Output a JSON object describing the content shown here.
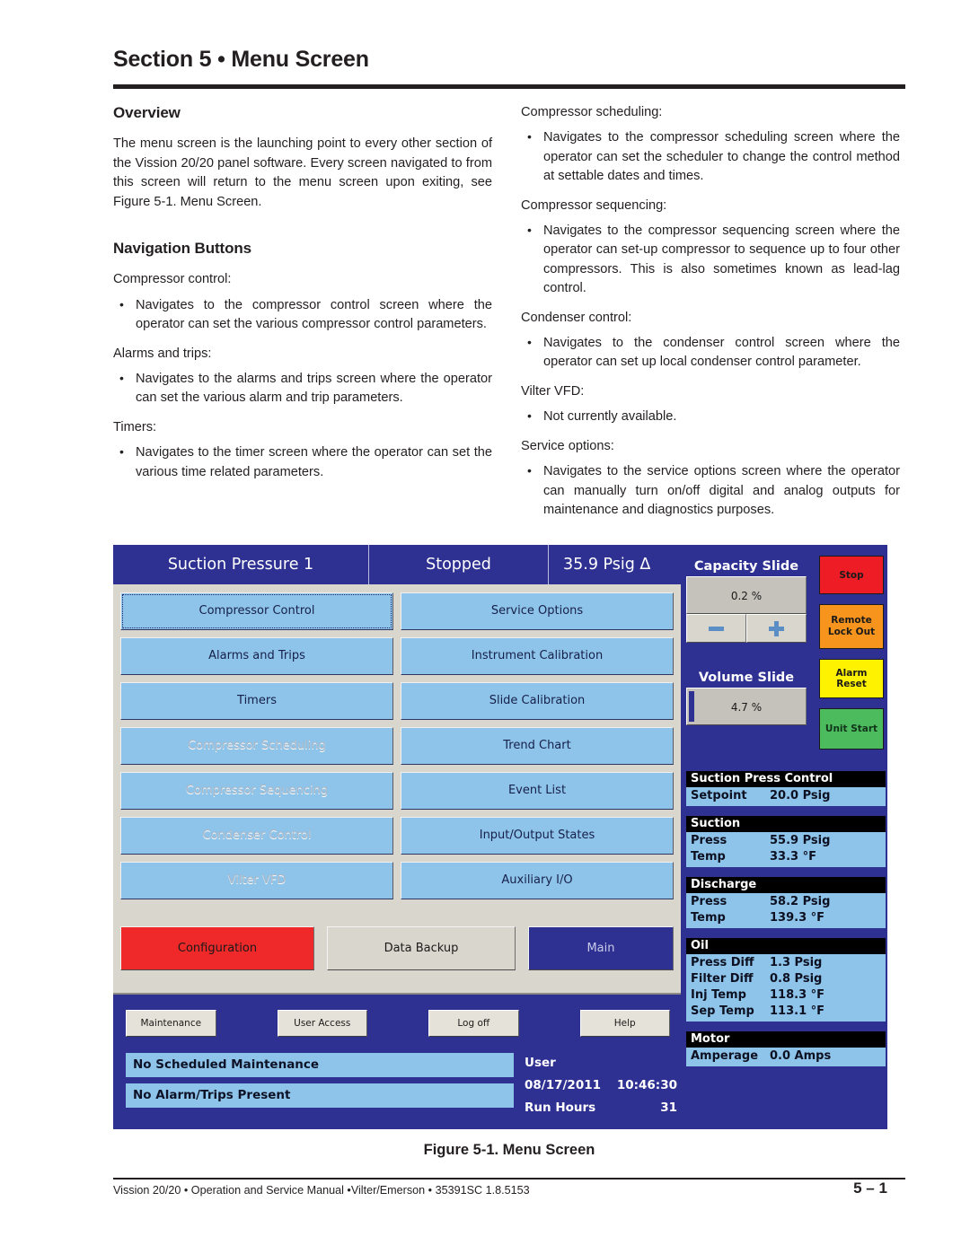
{
  "document": {
    "section_title": "Section 5 • Menu Screen",
    "figure_caption": "Figure 5-1. Menu Screen",
    "footer_text": "Vission 20/20 • Operation and Service Manual •Vilter/Emerson • 35391SC 1.8.5153",
    "page_number": "5  –  1"
  },
  "left_column": {
    "overview_heading": "Overview",
    "overview_paragraph": "The menu screen is the launching point to every other section of the Vission 20/20 panel software. Every screen navigated to from this screen will return to the menu screen upon exiting, see Figure 5-1. Menu Screen.",
    "nav_heading": "Navigation Buttons",
    "items": [
      {
        "lead": "Compressor control:",
        "bullet": "Navigates to the compressor control screen where the operator can set the various compressor control parameters."
      },
      {
        "lead": "Alarms and trips:",
        "bullet": "Navigates to the alarms and trips screen where the operator can set the various alarm and trip parameters."
      },
      {
        "lead": "Timers:",
        "bullet": "Navigates to the timer screen where the operator can set the various time related parameters."
      }
    ]
  },
  "right_column": {
    "items": [
      {
        "lead": "Compressor scheduling:",
        "bullet": "Navigates to the compressor scheduling screen where the operator can set the scheduler to change the control method at settable dates and times."
      },
      {
        "lead": "Compressor sequencing:",
        "bullet": "Navigates to the compressor sequencing screen where the operator can set-up compressor to sequence up to four other compressors. This is also sometimes known as lead-lag control."
      },
      {
        "lead": "Condenser control:",
        "bullet": "Navigates to the condenser control screen where the operator can set up local condenser control parameter."
      },
      {
        "lead": "Vilter VFD:",
        "bullet": "Not currently available."
      },
      {
        "lead": "Service options:",
        "bullet": "Navigates to the service options screen where the operator can manually turn on/off digital and analog outputs for maintenance and diagnostics purposes."
      }
    ]
  },
  "hmi": {
    "topbar": {
      "channel": "Suction Pressure 1",
      "state": "Stopped",
      "reading": "35.9 Psig Δ"
    },
    "nav_buttons_left": [
      {
        "label": "Compressor Control",
        "enabled": true,
        "focused": true
      },
      {
        "label": "Alarms and Trips",
        "enabled": true,
        "focused": false
      },
      {
        "label": "Timers",
        "enabled": true,
        "focused": false
      },
      {
        "label": "Compressor Scheduling",
        "enabled": false,
        "focused": false
      },
      {
        "label": "Compressor Sequencing",
        "enabled": false,
        "focused": false
      },
      {
        "label": "Condenser Control",
        "enabled": false,
        "focused": false
      },
      {
        "label": "Vilter VFD",
        "enabled": false,
        "focused": false
      }
    ],
    "nav_buttons_right": [
      {
        "label": "Service Options",
        "enabled": true
      },
      {
        "label": "Instrument Calibration",
        "enabled": true
      },
      {
        "label": "Slide Calibration",
        "enabled": true
      },
      {
        "label": "Trend Chart",
        "enabled": true
      },
      {
        "label": "Event List",
        "enabled": true
      },
      {
        "label": "Input/Output States",
        "enabled": true
      },
      {
        "label": "Auxiliary I/O",
        "enabled": true
      }
    ],
    "bottom_buttons": {
      "configuration": "Configuration",
      "data_backup": "Data Backup",
      "main": "Main"
    },
    "footer_buttons": {
      "maintenance": "Maintenance",
      "user_access": "User Access",
      "log_off": "Log off",
      "help": "Help"
    },
    "status": {
      "maintenance_status": "No Scheduled Maintenance",
      "alarm_status": "No Alarm/Trips Present",
      "user_label": "User",
      "date": "08/17/2011",
      "time": "10:46:30",
      "run_hours_label": "Run Hours",
      "run_hours_value": "31"
    },
    "slides": {
      "capacity_label": "Capacity Slide",
      "capacity_value": "0.2 %",
      "volume_label": "Volume Slide",
      "volume_value": "4.7 %",
      "minus_label": "−",
      "plus_label": "+"
    },
    "action_buttons": {
      "stop": "Stop",
      "remote_lock_out_line1": "Remote",
      "remote_lock_out_line2": "Lock Out",
      "alarm_reset": "Alarm Reset",
      "unit_start": "Unit Start"
    },
    "readouts": [
      {
        "title": "Suction Press Control",
        "rows": [
          {
            "key": "Setpoint",
            "value": "20.0 Psig"
          }
        ]
      },
      {
        "title": "Suction",
        "rows": [
          {
            "key": "Press",
            "value": "55.9 Psig"
          },
          {
            "key": "Temp",
            "value": "33.3 °F"
          }
        ]
      },
      {
        "title": "Discharge",
        "rows": [
          {
            "key": "Press",
            "value": "58.2 Psig"
          },
          {
            "key": "Temp",
            "value": "139.3 °F"
          }
        ]
      },
      {
        "title": "Oil",
        "rows": [
          {
            "key": "Press Diff",
            "value": "1.3 Psig"
          },
          {
            "key": "Filter Diff",
            "value": "0.8 Psig"
          },
          {
            "key": "Inj Temp",
            "value": "118.3 °F"
          },
          {
            "key": "Sep Temp",
            "value": "113.1 °F"
          }
        ]
      },
      {
        "title": "Motor",
        "rows": [
          {
            "key": "Amperage",
            "value": "0.0 Amps"
          }
        ]
      }
    ],
    "colors": {
      "panel_blue": "#2e3192",
      "button_blue": "#8ec4ea",
      "gray_panel": "#d9d6cd",
      "stop_red": "#ee1c25",
      "lock_orange": "#f7941d",
      "alarm_yellow": "#fff200",
      "start_green": "#4cbb5d",
      "config_red": "#ef2929"
    }
  }
}
